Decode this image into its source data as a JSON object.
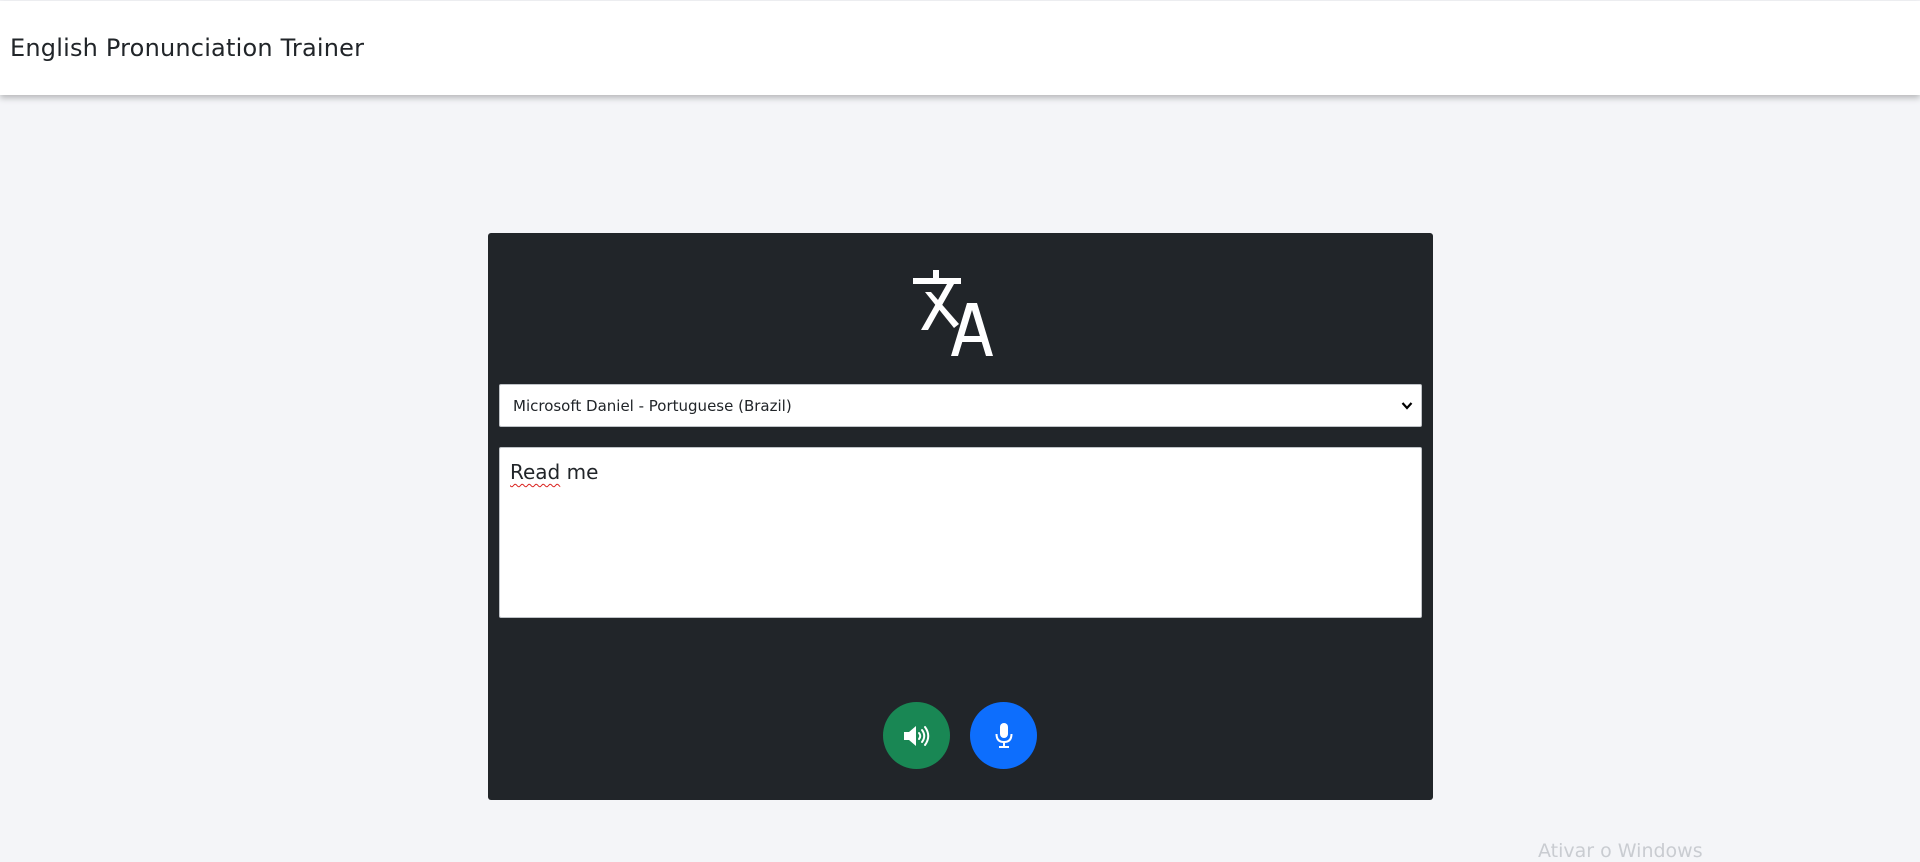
{
  "app": {
    "title": "English Pronunciation Trainer"
  },
  "icons": {
    "logo": "translate-icon",
    "speak": "volume-up-icon",
    "mic": "microphone-icon",
    "select_arrow": "chevron-down-icon"
  },
  "voice_select": {
    "selected": "Microsoft Daniel - Portuguese (Brazil)"
  },
  "text_input": {
    "word1": "Read",
    "word2": " me"
  },
  "watermark": {
    "text": "Ativar o Windows"
  },
  "colors": {
    "background": "#f4f5f8",
    "card": "#212529",
    "speak_button": "#198754",
    "mic_button": "#0d6efd"
  }
}
